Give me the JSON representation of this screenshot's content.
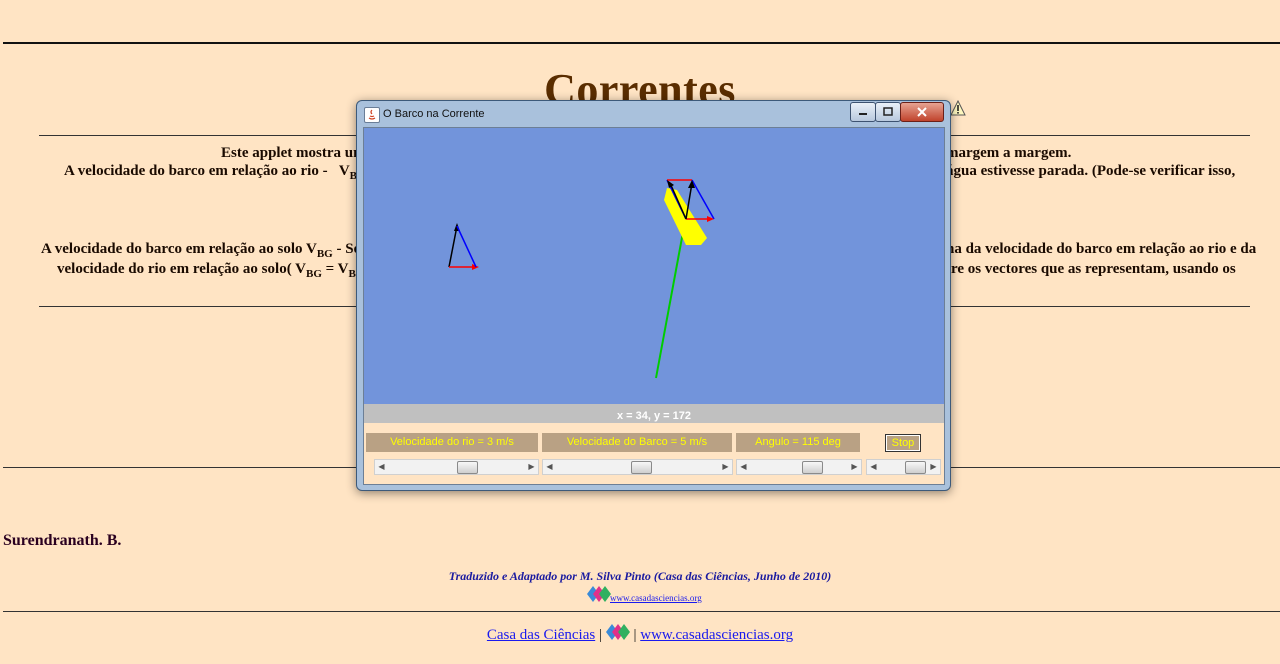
{
  "page": {
    "title": "Correntes",
    "intro_line1_left": "Este applet mostra um",
    "intro_line1_right": "margem a margem.",
    "intro_line2_left": "A velocidade do barco em relação ao rio -",
    "intro_line2_sym": "V",
    "intro_line2_sub": "BR",
    "intro_line2_right": "água estivesse parada. (Pode-se verificar isso,",
    "vbg_line1_left": "A velocidade do barco em relação ao solo V",
    "vbg_line1_sub": "BG",
    "vbg_line1_rest": " - Se",
    "vbg_line1_right": "na da velocidade do barco em relação ao rio e da",
    "vbg_line2_left": "velocidade do rio em relação ao solo( V",
    "vbg_line2_sub1": "BG",
    "vbg_line2_eq": " = V",
    "vbg_line2_sub2": "BR",
    "vbg_line2_right": "tre os vectores que as representam, usando os",
    "author": "Surendranath. B.",
    "credit": "Traduzido e Adaptado por M. Silva Pinto (Casa das Ciências, Junho de 2010)",
    "small_link": "www.casadasciencias.org",
    "footer_link1": "Casa das Ciências",
    "footer_sep": "|",
    "footer_link2": "www.casadasciencias.org"
  },
  "applet_window": {
    "title": "O Barco na Corrente",
    "coords": "x = 34,  y = 172",
    "river_label": "Velocidade do rio = 3 m/s",
    "boat_label": "Velocidade do Barco = 5 m/s",
    "angle_label": "Angulo = 115 deg",
    "stop_label": "Stop",
    "river_speed": 3,
    "boat_speed": 5,
    "angle_deg": 115,
    "colors": {
      "canvas": "#7294db",
      "boat": "#ffff00",
      "path": "#00cc00",
      "boat_vector": "#0000ff",
      "river_vector": "#ff0000",
      "ground_vector": "#000000",
      "label_bg": "#b9a184",
      "label_text": "#ffff00"
    }
  },
  "icons": [
    "java-icon",
    "minimize-icon",
    "maximize-icon",
    "close-icon",
    "warning-icon",
    "casa-logo-icon"
  ]
}
